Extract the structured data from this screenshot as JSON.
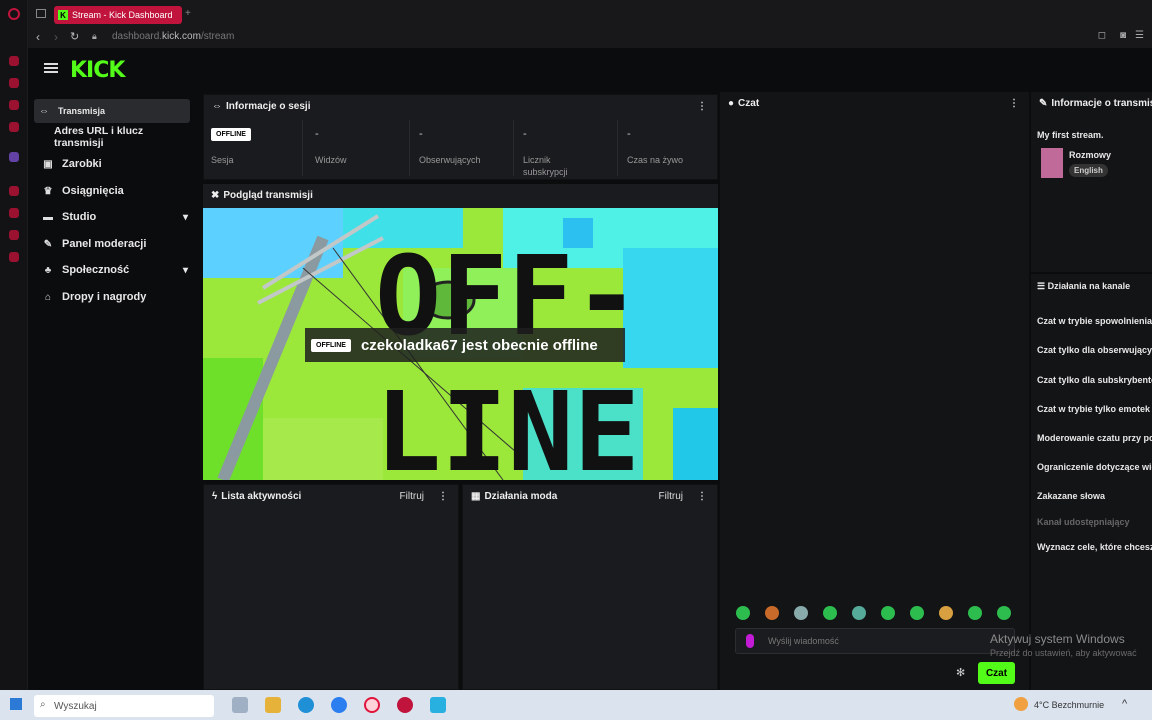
{
  "browser": {
    "tab_title": "Stream - Kick Dashboard",
    "url_prefix": "dashboard.",
    "url_domain": "kick.com",
    "url_path": "/stream"
  },
  "logo": "KICK",
  "sidebar": {
    "items": [
      {
        "label": "Transmisja",
        "icon": "broadcast-icon",
        "active": true
      },
      {
        "label": "Adres URL i klucz transmisji",
        "sub": true
      },
      {
        "label": "Zarobki",
        "icon": "money-icon"
      },
      {
        "label": "Osiągnięcia",
        "icon": "trophy-icon"
      },
      {
        "label": "Studio",
        "icon": "studio-icon",
        "chevron": true
      },
      {
        "label": "Panel moderacji",
        "icon": "wrench-icon"
      },
      {
        "label": "Społeczność",
        "icon": "community-icon",
        "chevron": true
      },
      {
        "label": "Dropy i nagrody",
        "icon": "gift-icon"
      }
    ]
  },
  "session": {
    "title": "Informacje o sesji",
    "badge": "OFFLINE",
    "stats": [
      {
        "value": "",
        "label": "Sesja"
      },
      {
        "value": "-",
        "label": "Widzów"
      },
      {
        "value": "-",
        "label": "Obserwujących"
      },
      {
        "value": "-",
        "label": "Licznik subskrypcji"
      },
      {
        "value": "-",
        "label": "Czas na żywo"
      }
    ]
  },
  "preview": {
    "title": "Podgląd transmisji",
    "badge": "OFFLINE",
    "message": "czekoladka67 jest obecnie offline",
    "big_text_1": "OFF-",
    "big_text_2": "LINE"
  },
  "activity": {
    "title": "Lista aktywności",
    "filter": "Filtruj"
  },
  "modactions": {
    "title": "Działania moda",
    "filter": "Filtruj"
  },
  "chat": {
    "title": "Czat",
    "placeholder": "Wyślij wiadomość",
    "send": "Czat"
  },
  "stream_info": {
    "title": "Informacje o transmisji",
    "stream_title": "My first stream.",
    "category": "Rozmowy",
    "language": "English"
  },
  "channel_actions": {
    "title": "Działania na kanale",
    "items": [
      "Czat w trybie spowolnienia",
      "Czat tylko dla obserwujących",
      "Czat tylko dla subskrybentów",
      "Czat w trybie tylko emotek",
      "Moderowanie czatu przy pomocy",
      "Ograniczenie dotyczące wieku",
      "Zakazane słowa",
      "Kanał udostępniający",
      "Wyznacz cele, które chcesz"
    ]
  },
  "taskbar": {
    "search": "Wyszukaj",
    "weather": "4°C Bezchmurnie"
  },
  "watermark": {
    "line1": "Aktywuj system Windows",
    "line2": "Przejdź do ustawień, aby aktywować"
  },
  "colors": {
    "accent": "#53fc18",
    "opera": "#c0143c"
  }
}
